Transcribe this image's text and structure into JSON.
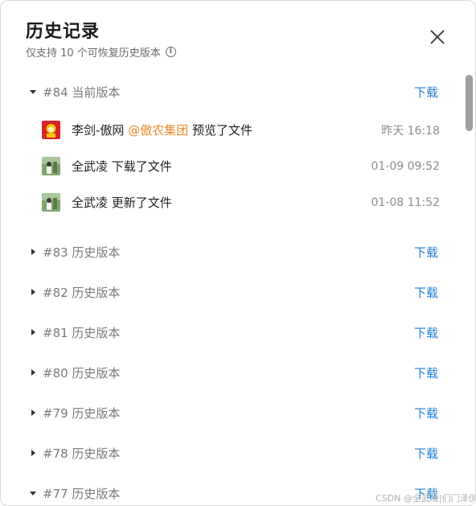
{
  "header": {
    "title": "历史记录",
    "subtitle": "仅支持 10 个可恢复历史版本",
    "info_icon": "info-icon",
    "close_icon": "close-icon"
  },
  "current_version": {
    "label": "#84 当前版本",
    "download_label": "下载",
    "expanded": true,
    "entries": [
      {
        "user": "李剑-傲网",
        "mention": "@傲农集团",
        "action": "预览了文件",
        "time": "昨天 16:18",
        "avatar": "red-avatar"
      },
      {
        "user": "全武凌",
        "mention": "",
        "action": "下载了文件",
        "time": "01-09 09:52",
        "avatar": "green-avatar"
      },
      {
        "user": "全武凌",
        "mention": "",
        "action": "更新了文件",
        "time": "01-08 11:52",
        "avatar": "green-avatar"
      }
    ]
  },
  "history_versions": [
    {
      "label": "#83 历史版本",
      "download_label": "下载",
      "expanded": false
    },
    {
      "label": "#82 历史版本",
      "download_label": "下载",
      "expanded": false
    },
    {
      "label": "#81 历史版本",
      "download_label": "下载",
      "expanded": false
    },
    {
      "label": "#80 历史版本",
      "download_label": "下载",
      "expanded": false
    },
    {
      "label": "#79 历史版本",
      "download_label": "下载",
      "expanded": false
    },
    {
      "label": "#78 历史版本",
      "download_label": "下载",
      "expanded": false
    },
    {
      "label": "#77 历史版本",
      "download_label": "下载",
      "expanded": true
    }
  ],
  "watermark": "CSDN @全武凌|们门泽优",
  "colors": {
    "link": "#1e7ed6",
    "mention": "#e8892a",
    "muted": "#7a7a7a"
  }
}
